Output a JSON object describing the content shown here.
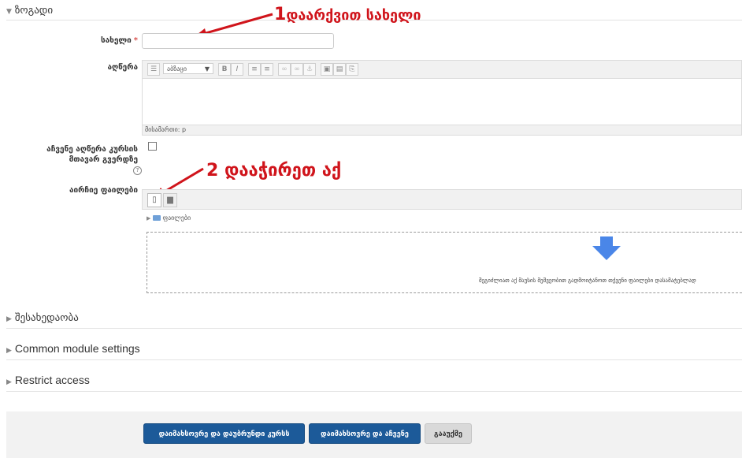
{
  "general": {
    "title": "ზოგადი",
    "name_label": "სახელი",
    "name_required": "*",
    "name_value": "",
    "description_label": "აღწერა",
    "editor": {
      "paragraph_select": "აბზაცი",
      "path": "მისამართი: p"
    },
    "show_description_label": "აჩვენე აღწერა კურსის მთავარ გვერდზე",
    "show_description_checked": false,
    "files_label": "აირჩიე ფაილები",
    "folder_label": "ფაილები",
    "drop_hint": "შეგიძლიათ აქ მაუსის მეშვეობით გადმოიტანოთ თქვენი ფაილები დასამატებლად"
  },
  "annotations": {
    "one_number": "1",
    "one_text": "დაარქვით სახელი",
    "two_number": "2",
    "two_text": "დააჭირეთ აქ"
  },
  "sections": {
    "appearance": "შესახედაობა",
    "common_module": "Common module settings",
    "restrict_access": "Restrict access"
  },
  "buttons": {
    "save_return": "დაიმახსოვრე და დაუბრუნდი კურსს",
    "save_display": "დაიმახსოვრე და აჩვენე",
    "cancel": "გააუქმე"
  },
  "colors": {
    "primary": "#1c5a99",
    "annotation": "#d0141b",
    "drop_arrow": "#4a86e8"
  }
}
